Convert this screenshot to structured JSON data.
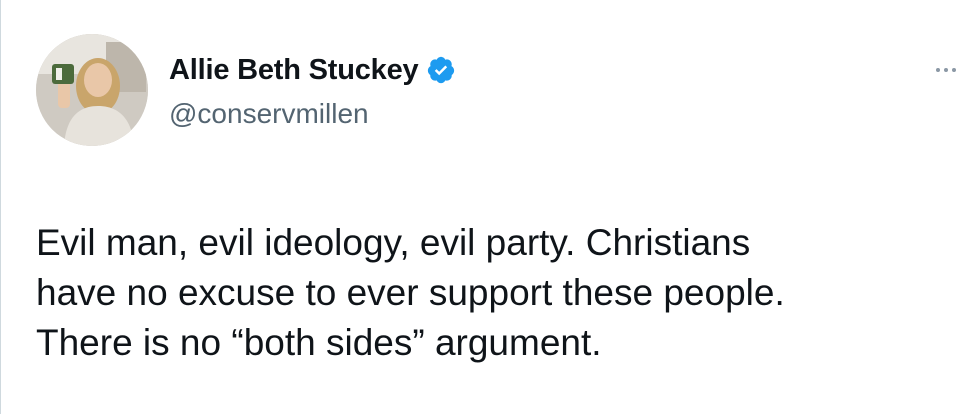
{
  "author": {
    "display_name": "Allie Beth Stuckey",
    "handle": "@conservmillen",
    "verified": true,
    "verified_color": "#1d9bf0",
    "avatar_icon": "profile-photo"
  },
  "menu": {
    "more_icon": "more-horizontal-icon"
  },
  "tweet": {
    "text_lines": [
      "Evil man, evil ideology, evil party. Christians",
      "have no excuse to ever support these people.",
      "There is no “both sides” argument."
    ]
  }
}
